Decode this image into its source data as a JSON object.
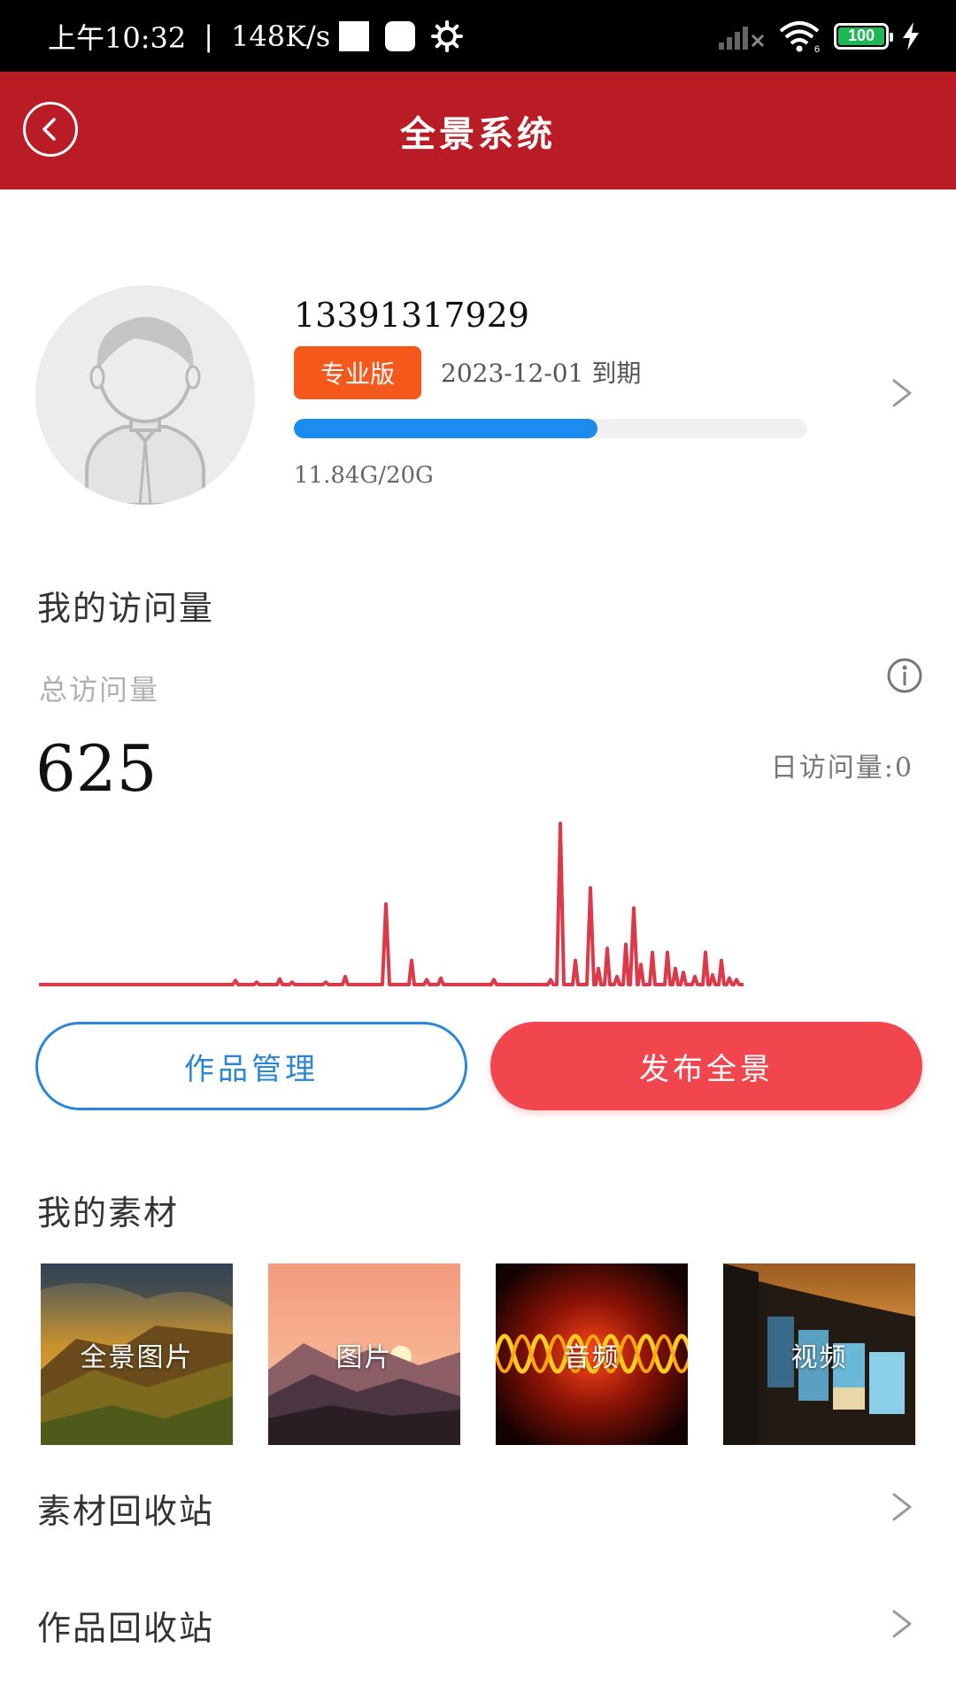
{
  "status_bar": {
    "time": "上午10:32",
    "separator": "|",
    "speed": "148K/s",
    "battery": "100"
  },
  "header": {
    "title": "全景系统"
  },
  "profile": {
    "phone": "13391317929",
    "plan_badge": "专业版",
    "expiry": "2023-12-01  到期",
    "storage_text": "11.84G/20G",
    "storage_used_fraction": 0.592
  },
  "visits": {
    "section_title": "我的访问量",
    "total_label": "总访问量",
    "total_value": "625",
    "daily_label": "日访问量:0"
  },
  "chart_data": {
    "type": "line",
    "title": "",
    "xlabel": "",
    "ylabel": "",
    "series": [
      {
        "values": [
          0,
          0,
          0,
          0,
          0,
          0,
          0,
          0,
          0,
          0,
          0,
          0,
          0,
          0,
          0,
          0,
          0,
          0,
          0,
          0,
          0,
          0,
          0,
          0,
          0,
          0,
          0,
          0,
          0,
          0,
          0,
          0,
          0,
          0,
          0,
          0,
          0,
          0,
          0,
          0,
          0,
          0,
          0,
          0,
          0,
          0,
          0,
          0,
          0,
          0,
          0,
          0,
          0,
          0,
          1,
          0,
          0,
          0,
          0,
          0,
          0,
          0,
          0,
          0,
          0,
          0,
          0,
          0,
          0,
          0,
          2,
          0,
          0,
          0,
          0,
          0,
          0,
          0,
          0,
          0,
          0,
          0,
          0,
          0,
          0,
          0,
          0,
          0,
          0,
          0,
          0,
          0,
          0,
          0,
          0,
          0,
          0,
          2,
          0,
          0,
          0,
          0,
          0,
          0,
          0,
          0,
          0,
          0,
          0,
          0,
          0,
          0,
          0,
          0,
          0,
          0,
          0,
          0,
          0,
          0,
          0,
          0,
          0,
          0,
          0,
          0,
          0,
          0,
          0,
          0,
          0,
          0,
          0,
          1,
          0,
          0,
          0,
          0,
          0,
          0,
          0,
          0,
          0,
          0,
          0,
          0,
          0,
          0,
          0,
          0,
          0,
          0,
          0,
          0,
          0,
          0,
          0,
          0,
          0,
          0,
          0,
          0,
          0,
          0,
          0,
          0,
          0,
          0,
          0,
          0,
          0,
          0,
          0,
          0,
          0,
          0,
          0,
          0,
          0,
          0,
          0,
          0,
          0,
          0,
          0,
          0,
          0,
          0,
          0,
          0,
          0,
          0,
          0,
          0,
          0,
          0,
          0,
          0,
          0,
          0,
          0,
          0,
          0,
          0,
          0,
          0,
          0,
          0,
          0,
          0,
          0,
          0,
          0,
          0,
          0,
          0,
          0,
          0,
          0,
          0,
          0,
          0,
          0,
          0,
          0,
          0,
          0,
          0,
          0,
          0,
          0,
          0,
          0,
          0,
          0,
          0,
          0,
          0,
          0,
          0,
          0,
          0,
          0,
          0,
          0,
          0,
          0,
          0,
          0,
          0,
          0,
          0,
          0,
          0,
          0,
          0,
          0,
          0,
          0,
          0,
          0,
          0,
          0,
          0,
          0,
          0,
          0,
          0,
          0,
          0,
          0,
          0,
          0,
          0,
          0,
          0,
          0,
          0,
          0,
          0,
          0,
          0,
          0,
          0,
          0,
          0,
          0,
          0,
          0,
          0,
          0,
          0,
          0,
          0,
          0,
          0,
          0,
          0,
          0,
          0,
          0,
          0,
          0,
          0,
          0,
          0,
          0,
          0,
          0,
          0,
          0,
          0,
          0,
          0,
          0,
          0,
          0,
          0,
          0,
          0,
          0,
          0,
          0,
          0,
          0,
          0,
          0,
          0,
          0,
          0,
          0,
          0,
          0,
          0,
          0,
          0,
          0,
          0,
          0,
          0,
          0,
          0,
          0
        ]
      }
    ],
    "peaks": [
      {
        "x": 266,
        "v": 0.5
      },
      {
        "x": 290,
        "v": 0.3
      },
      {
        "x": 316,
        "v": 0.7
      },
      {
        "x": 330,
        "v": 0.3
      },
      {
        "x": 368,
        "v": 0.3
      },
      {
        "x": 390,
        "v": 1.0
      },
      {
        "x": 436,
        "v": 10.0
      },
      {
        "x": 465,
        "v": 3.0
      },
      {
        "x": 482,
        "v": 0.6
      },
      {
        "x": 498,
        "v": 0.8
      },
      {
        "x": 558,
        "v": 0.6
      },
      {
        "x": 622,
        "v": 0.6
      },
      {
        "x": 633,
        "v": 20.0
      },
      {
        "x": 650,
        "v": 3.0
      },
      {
        "x": 667,
        "v": 12.0
      },
      {
        "x": 676,
        "v": 2.0
      },
      {
        "x": 686,
        "v": 4.5
      },
      {
        "x": 697,
        "v": 1.0
      },
      {
        "x": 707,
        "v": 5.0
      },
      {
        "x": 716,
        "v": 9.5
      },
      {
        "x": 724,
        "v": 2.5
      },
      {
        "x": 737,
        "v": 4.0
      },
      {
        "x": 754,
        "v": 4.0
      },
      {
        "x": 763,
        "v": 2.0
      },
      {
        "x": 772,
        "v": 1.5
      },
      {
        "x": 785,
        "v": 1.0
      },
      {
        "x": 797,
        "v": 4.0
      },
      {
        "x": 805,
        "v": 1.2
      },
      {
        "x": 815,
        "v": 3.0
      },
      {
        "x": 824,
        "v": 0.8
      },
      {
        "x": 832,
        "v": 0.6
      }
    ],
    "x_range": [
      44,
      840
    ],
    "ylim": [
      0,
      20
    ],
    "color": "#dc3a4a"
  },
  "actions": {
    "manage_label": "作品管理",
    "publish_label": "发布全景"
  },
  "materials": {
    "section_title": "我的素材",
    "items": [
      {
        "label": "全景图片"
      },
      {
        "label": "图片"
      },
      {
        "label": "音频"
      },
      {
        "label": "视频"
      }
    ]
  },
  "list": {
    "material_recycle": "素材回收站",
    "work_recycle": "作品回收站"
  },
  "colors": {
    "header_bg": "#b91c24",
    "accent_red": "#f2464f",
    "accent_blue": "#2a86d6",
    "badge_orange": "#f4591b",
    "progress_blue": "#1a8cf0"
  }
}
